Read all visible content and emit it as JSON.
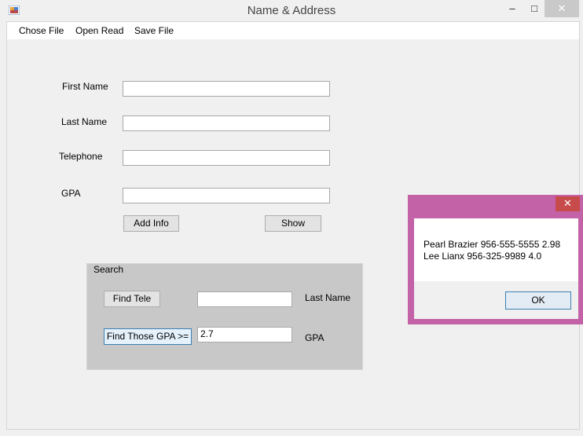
{
  "window": {
    "title": "Name & Address",
    "minimize_glyph": "–",
    "maximize_glyph": "□",
    "close_glyph": "✕"
  },
  "menu": {
    "items": [
      "Chose File",
      "Open Read",
      "Save File"
    ]
  },
  "form": {
    "first_name": {
      "label": "First Name",
      "value": ""
    },
    "last_name": {
      "label": "Last Name",
      "value": ""
    },
    "telephone": {
      "label": "Telephone",
      "value": ""
    },
    "gpa": {
      "label": "GPA",
      "value": ""
    },
    "add_info_label": "Add Info",
    "show_label": "Show"
  },
  "search": {
    "group_label": "Search",
    "find_tele_label": "Find Tele",
    "tele_value": "",
    "last_name_label": "Last Name",
    "find_gpa_label": "Find Those GPA >=",
    "gpa_value": "2.7",
    "gpa_label": "GPA"
  },
  "message_box": {
    "close_glyph": "✕",
    "lines": [
      "Pearl Brazier 956-555-5555 2.98",
      "Lee Lianx 956-325-9989 4.0"
    ],
    "ok_label": "OK"
  },
  "colors": {
    "msgbox_frame": "#c462a8",
    "close_red": "#c74b4b",
    "ok_border": "#3c7fb1"
  },
  "icons": {
    "app": "winforms-app-icon"
  }
}
